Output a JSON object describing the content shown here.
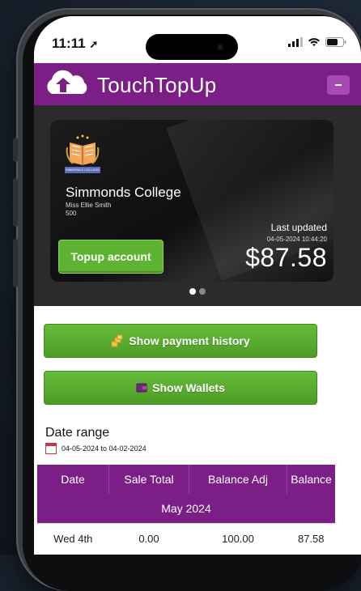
{
  "status_bar": {
    "time": "11:11"
  },
  "app": {
    "title": "TouchTopUp"
  },
  "card": {
    "school_name": "Simmonds College",
    "student_name": "Miss Ellie Smith",
    "student_code": "500",
    "topup_label": "Topup account",
    "last_updated_label": "Last updated",
    "last_updated_time": "04-05-2024 10:44:20",
    "balance": "$87.58",
    "badge_text": "SIMMONDS COLLEGE"
  },
  "carousel": {
    "pages": 2,
    "active_index": 0
  },
  "buttons": {
    "payment_history": "Show payment history",
    "wallets": "Show Wallets"
  },
  "date_range": {
    "title": "Date range",
    "value": "04-05-2024 to 04-02-2024"
  },
  "table": {
    "columns": [
      "Date",
      "Sale Total",
      "Balance Adj",
      "Balance"
    ],
    "month_label": "May 2024",
    "rows": [
      {
        "date": "Wed 4th",
        "sale_total": "0.00",
        "balance_adj": "100.00",
        "balance": "87.58"
      }
    ]
  },
  "colors": {
    "accent_purple": "#7b1f86",
    "button_green": "#5fb333",
    "card_black": "#111111"
  }
}
